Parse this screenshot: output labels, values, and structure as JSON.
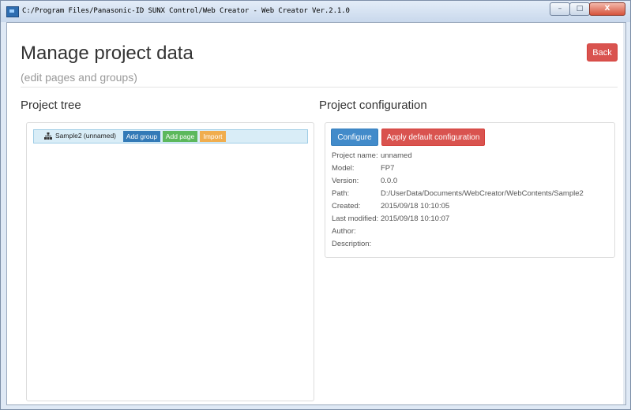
{
  "window": {
    "title": "C:/Program Files/Panasonic-ID SUNX Control/Web Creator - Web Creator Ver.2.1.0",
    "controls": {
      "minimize": "–",
      "maximize": "□",
      "close": "X"
    }
  },
  "header": {
    "title": "Manage project data",
    "subtitle": "(edit pages and groups)",
    "back_label": "Back"
  },
  "tree": {
    "heading": "Project tree",
    "root": {
      "label": "Sample2 (unnamed)",
      "add_group_label": "Add group",
      "add_page_label": "Add page",
      "import_label": "Import"
    }
  },
  "config": {
    "heading": "Project configuration",
    "configure_label": "Configure",
    "apply_default_label": "Apply default configuration",
    "fields": {
      "project_name": {
        "label": "Project name:",
        "value": "unnamed"
      },
      "model": {
        "label": "Model:",
        "value": "FP7"
      },
      "version": {
        "label": "Version:",
        "value": "0.0.0"
      },
      "path": {
        "label": "Path:",
        "value": "D:/UserData/Documents/WebCreator/WebContents/Sample2"
      },
      "created": {
        "label": "Created:",
        "value": "2015/09/18 10:10:05"
      },
      "last_modified": {
        "label": "Last modified:",
        "value": "2015/09/18 10:10:07"
      },
      "author": {
        "label": "Author:",
        "value": ""
      },
      "description": {
        "label": "Description:",
        "value": ""
      }
    }
  },
  "colors": {
    "primary": "#428bca",
    "danger": "#d9534f",
    "success": "#5cb85c",
    "warning": "#f0ad4e",
    "tree_node_bg": "#d9edf7"
  }
}
